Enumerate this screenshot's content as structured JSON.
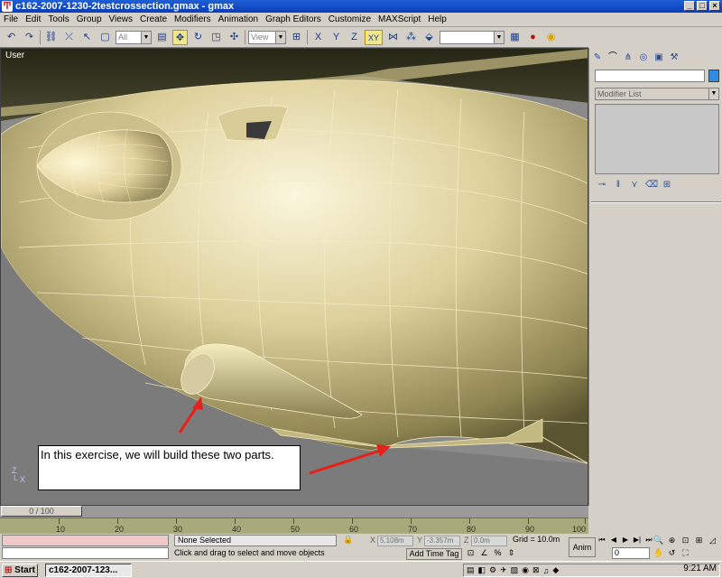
{
  "window": {
    "title": "c162-2007-1230-2testcrossection.gmax - gmax",
    "icon": "gmax-logo-icon",
    "minimize": "_",
    "maximize": "□",
    "close": "×"
  },
  "menu": [
    "File",
    "Edit",
    "Tools",
    "Group",
    "Views",
    "Create",
    "Modifiers",
    "Animation",
    "Graph Editors",
    "Customize",
    "MAXScript",
    "Help"
  ],
  "toolbar": {
    "selection_filter": "All",
    "reference_coord": "View",
    "xy_constraint": "XY",
    "named_sets": ""
  },
  "viewport": {
    "label": "User",
    "annotation": "In this exercise, we will build these two parts.",
    "arrow_color": "#e8201a",
    "mesh_color": "#e6dcaa",
    "background": "#8a8a8a"
  },
  "command_panel": {
    "object_name": "",
    "object_color": "#2e8be0",
    "modifier_list": "Modifier List"
  },
  "timeline": {
    "slider": "0 / 100",
    "ticks": [
      "10",
      "20",
      "30",
      "40",
      "50",
      "60",
      "70",
      "80",
      "90",
      "100"
    ]
  },
  "status": {
    "selection": "None Selected",
    "prompt": "Click and drag to select and move objects",
    "x_label": "X",
    "x_value": "5.108m",
    "y_label": "Y",
    "y_value": "-3.357m",
    "z_label": "Z",
    "z_value": "0.0m",
    "grid": "Grid = 10.0m",
    "add_time_tag": "Add Time Tag",
    "anim": "Anim",
    "frame": "0"
  },
  "taskbar": {
    "start": "Start",
    "task_item": "c162-2007-123...",
    "clock": "9:21 AM"
  }
}
